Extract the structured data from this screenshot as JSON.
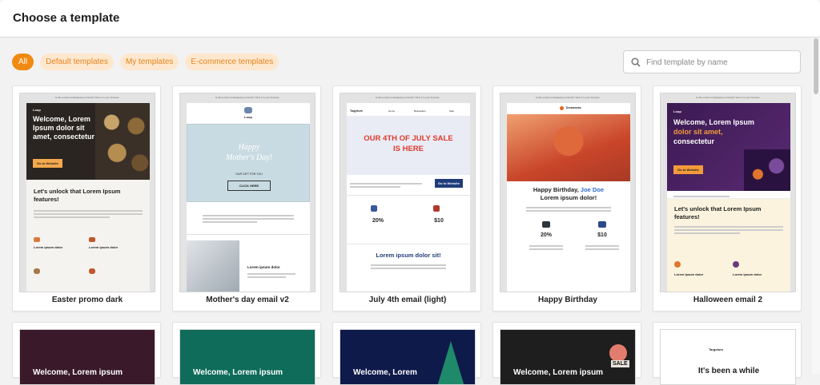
{
  "dialog": {
    "title": "Choose a template"
  },
  "filters": [
    {
      "label": "All",
      "active": true
    },
    {
      "label": "Default templates",
      "active": false
    },
    {
      "label": "My templates",
      "active": false
    },
    {
      "label": "E-commerce templates",
      "active": false
    }
  ],
  "search": {
    "placeholder": "Find template by name",
    "icon": "search-icon"
  },
  "colors": {
    "accent": "#f08a13",
    "chip_bg": "#fde8cf"
  },
  "templates": [
    {
      "name": "Easter promo dark",
      "topline": "Is this email not displaying correctly? View it in your browser.",
      "logo": "Loop",
      "headline": "Welcome, Lorem Ipsum dolor sit amet, consectetur",
      "button": "Go to Website",
      "subhead": "Let's unlock that Lorem Ipsum features!",
      "item1": "Lorem ipsum dolor",
      "item2": "Lorem ipsum dolor"
    },
    {
      "name": "Mother's day email v2",
      "topline": "Is this email not displaying correctly? View it in your browser.",
      "logo": "Loop",
      "headline": "Happy Mother's Day!",
      "gift": "OUR GIFT FOR YOU",
      "button": "CLICK HERE",
      "caption": "Lorem ipsum dolor"
    },
    {
      "name": "July 4th email (light)",
      "topline": "Is this email not displaying correctly? View it in your browser.",
      "logo": "Targetum",
      "nav": [
        "Home",
        "Bestsellers",
        "Sale"
      ],
      "headline": "OUR 4TH OF JULY SALE IS HERE",
      "button": "Go to Website",
      "p1": "20%",
      "p2": "$10",
      "subhead": "Lorem ipsum dolor sit!"
    },
    {
      "name": "Happy Birthday",
      "topline": "Is this email not displaying correctly? View it in your browser.",
      "logo": "Dreamseas",
      "headline_a": "Happy Birthday,",
      "headline_name": "Joe Doe",
      "headline_b": "Lorem ipsum dolor!",
      "p1": "20%",
      "p2": "$10"
    },
    {
      "name": "Halloween email 2",
      "topline": "Is this email not displaying correctly? View it in your browser.",
      "logo": "Loop",
      "headline_a": "Welcome, Lorem Ipsum",
      "headline_b": "dolor sit amet,",
      "headline_c": "consectetur",
      "button": "Go to Website",
      "subhead": "Let's unlock that Lorem Ipsum features!",
      "item1": "Lorem ipsum dolor",
      "item2": "Lorem ipsum dolor"
    }
  ],
  "row2": [
    {
      "headline": "Welcome, Lorem ipsum"
    },
    {
      "headline": "Welcome, Lorem ipsum"
    },
    {
      "headline": "Welcome, Lorem"
    },
    {
      "headline": "Welcome, Lorem ipsum",
      "badge": "SALE"
    },
    {
      "logo": "Targetum",
      "headline": "It's been a while"
    }
  ]
}
